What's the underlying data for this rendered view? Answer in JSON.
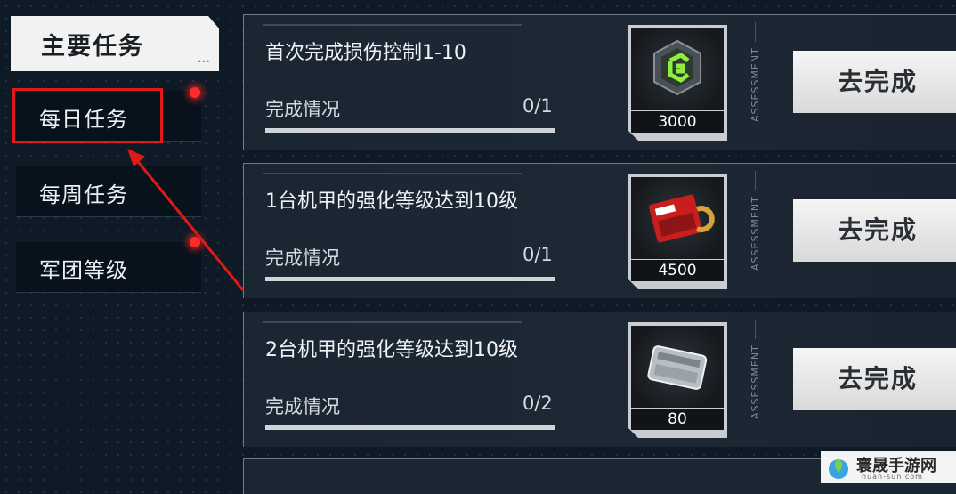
{
  "sidebar": {
    "main_tab": "主要任务",
    "tabs": [
      {
        "label": "每日任务",
        "badge": true,
        "selected": true
      },
      {
        "label": "每周任务",
        "badge": false,
        "selected": false
      },
      {
        "label": "军团等级",
        "badge": true,
        "selected": false
      }
    ]
  },
  "tasks": [
    {
      "title": "首次完成损伤控制1-10",
      "progress_label": "完成情况",
      "progress": "0/1",
      "progress_fraction": 0,
      "reward_icon": "chip-token-icon",
      "reward_amount": "3000",
      "assess_label": "ASSESSMENT",
      "button": "去完成"
    },
    {
      "title": "1台机甲的强化等级达到10级",
      "progress_label": "完成情况",
      "progress": "0/1",
      "progress_fraction": 0,
      "reward_icon": "data-card-icon",
      "reward_amount": "4500",
      "assess_label": "ASSESSMENT",
      "button": "去完成"
    },
    {
      "title": "2台机甲的强化等级达到10级",
      "progress_label": "完成情况",
      "progress": "0/2",
      "progress_fraction": 0,
      "reward_icon": "supply-crate-icon",
      "reward_amount": "80",
      "assess_label": "ASSESSMENT",
      "button": "去完成"
    }
  ],
  "watermark": {
    "title": "寰晟手游网",
    "url": "huan-sun.com"
  },
  "colors": {
    "accent_red": "#e01818",
    "button_bg": "#eeeeee",
    "panel_bg": "#1b2633"
  }
}
